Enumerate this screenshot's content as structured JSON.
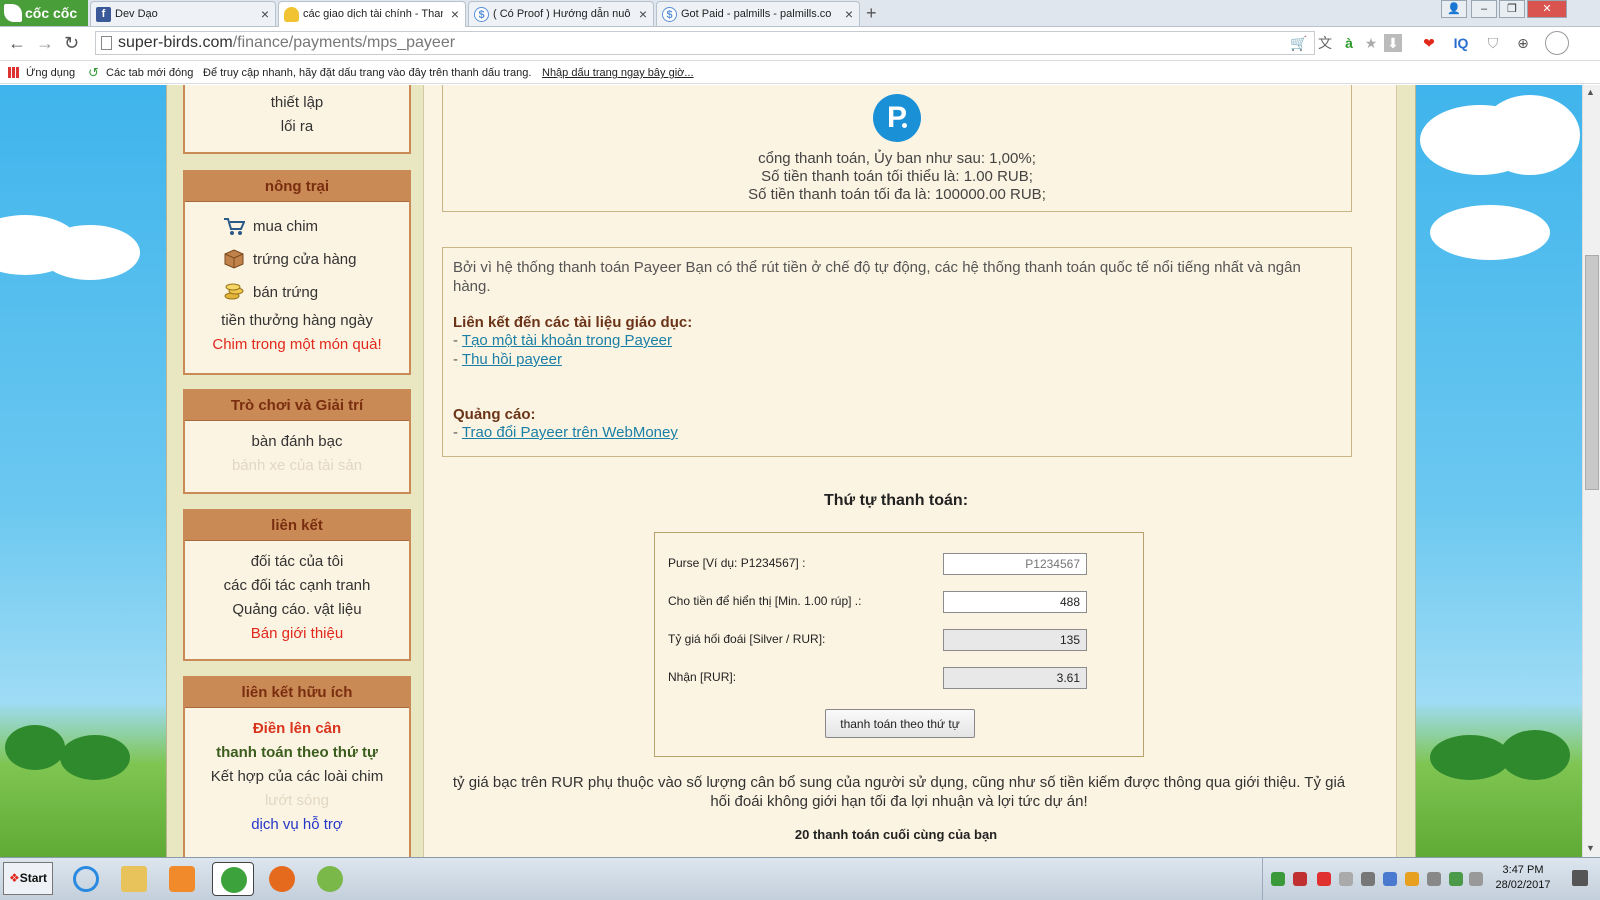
{
  "browser": {
    "logo_text": "cốc cốc",
    "tabs": [
      {
        "label": "Dev Dạo",
        "icon_name": "facebook-icon",
        "icon_glyph": "f",
        "color": "#3b5998"
      },
      {
        "label": "các giao dịch tài chính - Thanh",
        "icon_name": "super-birds-icon",
        "icon_glyph": "",
        "color": "#f1c232"
      },
      {
        "label": "( Có Proof ) Hướng dẫn nuôi c",
        "icon_name": "dollar-circle-icon",
        "icon_glyph": "$",
        "color": "#5a8fd6"
      },
      {
        "label": "Got Paid - palmills - palmills.co",
        "icon_name": "dollar-circle-icon",
        "icon_glyph": "$",
        "color": "#5a8fd6"
      }
    ],
    "url_host": "super-birds.com",
    "url_path": "/finance/payments/mps_payeer",
    "bookmarks": {
      "apps": "Ứng dụng",
      "recent": "Các tab mới đóng",
      "hint": "Để truy cập nhanh, hãy đặt dấu trang vào đây trên thanh dấu trang.",
      "import": "Nhập dấu trang ngay bây giờ..."
    }
  },
  "sidebar": {
    "top": {
      "items": [
        "thiết lập",
        "lối ra"
      ]
    },
    "farm": {
      "title": "nông trại",
      "items": [
        {
          "label": "mua chim",
          "icon": "cart-icon"
        },
        {
          "label": "trứng cửa hàng",
          "icon": "box-icon"
        },
        {
          "label": "bán trứng",
          "icon": "coins-icon"
        }
      ],
      "daily": "tiền thưởng hàng ngày",
      "gift": "Chim trong một món quà!"
    },
    "games": {
      "title": "Trò chơi và Giải trí",
      "items": [
        "bàn đánh bạc",
        "bánh xe của tài sản"
      ]
    },
    "links": {
      "title": "liên kết",
      "items": [
        "đối tác của tôi",
        "các đối tác cạnh tranh",
        "Quảng cáo. vật liệu",
        "Bán giới thiệu"
      ]
    },
    "useful": {
      "title": "liên kết hữu ích",
      "items": [
        "Điền lên cân",
        "thanh toán theo thứ tự",
        "Kết hợp của các loài chim",
        "lướt sóng",
        "dịch vụ hỗ trợ"
      ]
    }
  },
  "payeer": {
    "logo_letter": "P",
    "line1": "cổng thanh toán, Ủy ban như sau: 1,00%;",
    "line2": "Số tiền thanh toán tối thiểu là: 1.00 RUB;",
    "line3": "Số tiền thanh toán tối đa là: 100000.00 RUB;"
  },
  "info": {
    "intro": "Bởi vì hệ thống thanh toán Payeer Bạn có thể rút tiền ở chế độ tự động, các hệ thống thanh toán quốc tế nổi tiếng nhất và ngân hàng.",
    "edu_title": "Liên kết đến các tài liệu giáo dục:",
    "edu_links": [
      "Tạo một tài khoản trong Payeer",
      "Thu hồi payeer "
    ],
    "ads_title": "Quảng cáo:",
    "ads_links": [
      "Trao đổi Payeer trên WebMoney"
    ]
  },
  "order": {
    "title": "Thứ tự thanh toán:",
    "purse_label": "Purse [Ví dụ: P1234567] :",
    "purse_placeholder": "P1234567",
    "amount_label": "Cho tiền để hiển thị [Min. 1.00 rúp] .:",
    "amount_value": "488",
    "rate_label": "Tỷ giá hối đoái [Silver / RUR]:",
    "rate_value": "135",
    "receive_label": "Nhận [RUR]:",
    "receive_value": "3.61",
    "button": "thanh toán theo thứ tự"
  },
  "note": "tỷ giá bạc trên RUR phụ thuộc vào số lượng cân bổ sung của người sử dụng, cũng như số tiền kiếm được thông qua giới thiệu. Tỷ giá hối đoái không giới hạn tối đa lợi nhuận và lợi tức dự án!",
  "last_payments_title": "20 thanh toán cuối cùng của bạn",
  "taskbar": {
    "start": "Start",
    "time": "3:47 PM",
    "date": "28/02/2017"
  },
  "colors": {
    "sidebar_header": "#c98a55",
    "panel_bg": "#fcf4e2",
    "link": "#1a7fa6",
    "accent_red": "#e0281c",
    "payeer_blue": "#1a90d6"
  }
}
